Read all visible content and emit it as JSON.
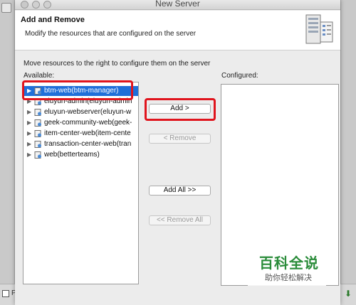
{
  "window": {
    "title": "New Server"
  },
  "header": {
    "title": "Add and Remove",
    "description": "Modify the resources that are configured on the server"
  },
  "instruction": "Move resources to the right to configure them on the server",
  "available": {
    "label": "Available:",
    "items": [
      {
        "label": "btm-web(btm-manager)",
        "selected": true
      },
      {
        "label": "eluyun-admin(eluyun-admin",
        "selected": false
      },
      {
        "label": "eluyun-webserver(eluyun-w",
        "selected": false
      },
      {
        "label": "geek-community-web(geek-",
        "selected": false
      },
      {
        "label": "item-center-web(item-cente",
        "selected": false
      },
      {
        "label": "transaction-center-web(tran",
        "selected": false
      },
      {
        "label": "web(betterteams)",
        "selected": false
      }
    ]
  },
  "configured": {
    "label": "Configured:",
    "items": []
  },
  "buttons": {
    "add": "Add >",
    "remove": "< Remove",
    "add_all": "Add All >>",
    "remove_all": "<< Remove All"
  },
  "background": {
    "bottom_label": "P"
  },
  "watermark": {
    "title": "百科全说",
    "subtitle": "助你轻松解决"
  },
  "colors": {
    "selection": "#1f6fd9",
    "highlight": "#e0141d",
    "watermark": "#2a8c3a"
  },
  "icons": {
    "tree_expand": "triangle-right-icon",
    "module": "web-module-icon",
    "server_art": "server-stack-icon"
  }
}
